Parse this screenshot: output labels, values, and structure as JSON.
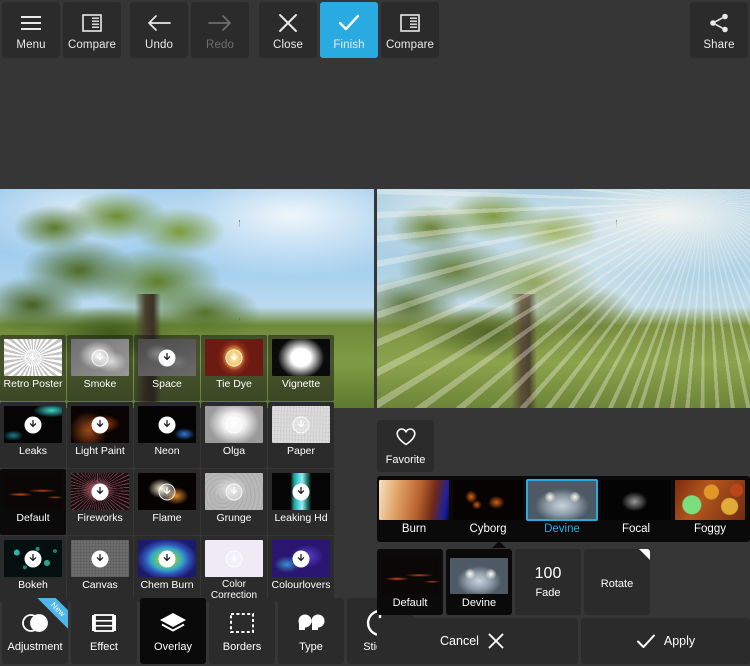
{
  "app": {
    "accent_color": "#29ABE2",
    "background_color": "#363636",
    "panel_color": "#2b2b2b"
  },
  "toolbar": {
    "groups": [
      {
        "buttons": [
          {
            "label": "Menu",
            "icon": "hamburger-menu-icon",
            "state": "normal"
          },
          {
            "label": "Compare",
            "icon": "compare-split-icon",
            "state": "normal"
          }
        ]
      },
      {
        "buttons": [
          {
            "label": "Undo",
            "icon": "arrow-left-icon",
            "state": "normal"
          },
          {
            "label": "Redo",
            "icon": "arrow-right-icon",
            "state": "disabled"
          }
        ]
      },
      {
        "buttons": [
          {
            "label": "Close",
            "icon": "close-x-icon",
            "state": "normal"
          },
          {
            "label": "Finish",
            "icon": "checkmark-icon",
            "state": "accent"
          },
          {
            "label": "Compare",
            "icon": "compare-split-icon",
            "state": "normal"
          }
        ]
      }
    ],
    "share": {
      "label": "Share",
      "icon": "share-nodes-icon"
    }
  },
  "preview": {
    "left_label": "original-photo",
    "right_label": "edited-photo-with-overlay"
  },
  "overlay_grid": {
    "rows": [
      [
        {
          "label": "Retro Poster",
          "thumb": "t-retro",
          "badge": "download-ghost",
          "selected": false,
          "translucent": true
        },
        {
          "label": "Smoke",
          "thumb": "t-smoke",
          "badge": "download-ghost",
          "selected": false,
          "translucent": true
        },
        {
          "label": "Space",
          "thumb": "t-space",
          "badge": "download-solid",
          "selected": false,
          "translucent": true
        },
        {
          "label": "Tie Dye",
          "thumb": "t-tiedye",
          "badge": "download-ghost",
          "selected": false,
          "translucent": true
        },
        {
          "label": "Vignette",
          "thumb": "t-vignette",
          "badge": "download-ghost",
          "selected": false,
          "translucent": true
        }
      ],
      [
        {
          "label": "Leaks",
          "thumb": "t-leaks",
          "badge": "download-solid",
          "selected": false,
          "translucent": false
        },
        {
          "label": "Light Paint",
          "thumb": "t-lightpaint",
          "badge": "download-solid",
          "selected": false,
          "translucent": false
        },
        {
          "label": "Neon",
          "thumb": "t-neon",
          "badge": "download-solid",
          "selected": false,
          "translucent": false
        },
        {
          "label": "Olga",
          "thumb": "t-olga",
          "badge": "download-ghost",
          "selected": false,
          "translucent": false
        },
        {
          "label": "Paper",
          "thumb": "t-paper",
          "badge": "download-ghost",
          "selected": false,
          "translucent": false
        }
      ],
      [
        {
          "label": "Default",
          "thumb": "t-default",
          "badge": "none",
          "selected": true,
          "translucent": false
        },
        {
          "label": "Fireworks",
          "thumb": "t-fireworks",
          "badge": "download-solid",
          "selected": false,
          "translucent": false
        },
        {
          "label": "Flame",
          "thumb": "t-flame",
          "badge": "download-ghost",
          "selected": false,
          "translucent": false
        },
        {
          "label": "Grunge",
          "thumb": "t-grunge",
          "badge": "download-ghost",
          "selected": false,
          "translucent": false
        },
        {
          "label": "Leaking Hd",
          "thumb": "t-leakinghd",
          "badge": "download-solid",
          "selected": false,
          "translucent": false
        }
      ],
      [
        {
          "label": "Bokeh",
          "thumb": "t-bokeh",
          "badge": "download-solid",
          "selected": false,
          "translucent": false
        },
        {
          "label": "Canvas",
          "thumb": "t-canvas",
          "badge": "download-solid",
          "selected": false,
          "translucent": false
        },
        {
          "label": "Chem Burn",
          "thumb": "t-chemburn",
          "badge": "download-solid",
          "selected": false,
          "translucent": false
        },
        {
          "label": "Color Correction",
          "thumb": "t-colorcorrection",
          "badge": "download-ghost",
          "selected": false,
          "translucent": false
        },
        {
          "label": "Colourlovers",
          "thumb": "t-colourlovers",
          "badge": "download-solid",
          "selected": false,
          "translucent": false
        }
      ]
    ]
  },
  "bottom_nav": {
    "items": [
      {
        "label": "Adjustment",
        "icon": "overlapping-circles-icon",
        "active": false,
        "badge": "New"
      },
      {
        "label": "Effect",
        "icon": "film-strip-icon",
        "active": false,
        "badge": ""
      },
      {
        "label": "Overlay",
        "icon": "layers-stack-icon",
        "active": true,
        "badge": ""
      },
      {
        "label": "Borders",
        "icon": "dashed-frame-icon",
        "active": false,
        "badge": ""
      },
      {
        "label": "Type",
        "icon": "quote-marks-icon",
        "active": false,
        "badge": ""
      },
      {
        "label": "Sticker",
        "icon": "circle-outline-icon",
        "active": false,
        "badge": ""
      }
    ]
  },
  "right_panel": {
    "favorite": {
      "label": "Favorite",
      "icon": "heart-outline-icon"
    },
    "filter_strip": [
      {
        "label": "Burn",
        "thumb": "s-burn",
        "selected": false
      },
      {
        "label": "Cyborg",
        "thumb": "s-cyborg",
        "selected": false
      },
      {
        "label": "Devine",
        "thumb": "s-devine",
        "selected": true
      },
      {
        "label": "Focal",
        "thumb": "s-focal",
        "selected": false
      },
      {
        "label": "Foggy",
        "thumb": "s-foggy",
        "selected": false
      }
    ],
    "controls": [
      {
        "type": "preset",
        "label": "Default",
        "thumb": "t-default",
        "dark": true
      },
      {
        "type": "preset",
        "label": "Devine",
        "thumb": "s-devine",
        "dark": true
      },
      {
        "type": "value",
        "value": "100",
        "label": "Fade",
        "dark": false
      },
      {
        "type": "action",
        "label": "Rotate",
        "dark": false,
        "corner_marker": true
      }
    ],
    "actions": {
      "cancel": {
        "label": "Cancel",
        "icon": "close-x-icon"
      },
      "apply": {
        "label": "Apply",
        "icon": "checkmark-icon"
      }
    }
  }
}
